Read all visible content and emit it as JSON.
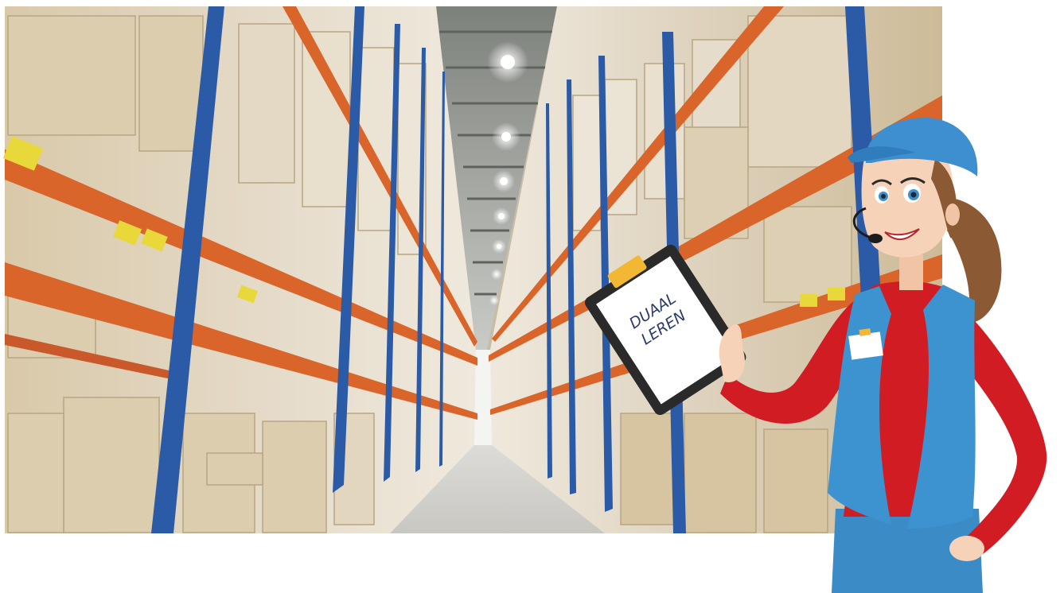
{
  "clipboard": {
    "line1": "DUAAL",
    "line2": "LEREN"
  },
  "colors": {
    "background": "#ffffff",
    "floor": "#d9d9d6",
    "ceiling": "#9a9d98",
    "rack_upright_blue": "#2b5aa6",
    "rack_beam_orange": "#d9652a",
    "box_cardboard": "#d8c6a4",
    "shirt_red": "#d21c24",
    "vest_blue": "#3c93cf",
    "cap_blue": "#3d8fd0",
    "hair_brown": "#8b5a34",
    "skin": "#f6d2b8"
  },
  "icons": {
    "character": "warehouse-worker-illustration-icon",
    "clipboard": "clipboard-icon",
    "headset": "headset-icon",
    "name_badge": "name-badge-icon"
  }
}
